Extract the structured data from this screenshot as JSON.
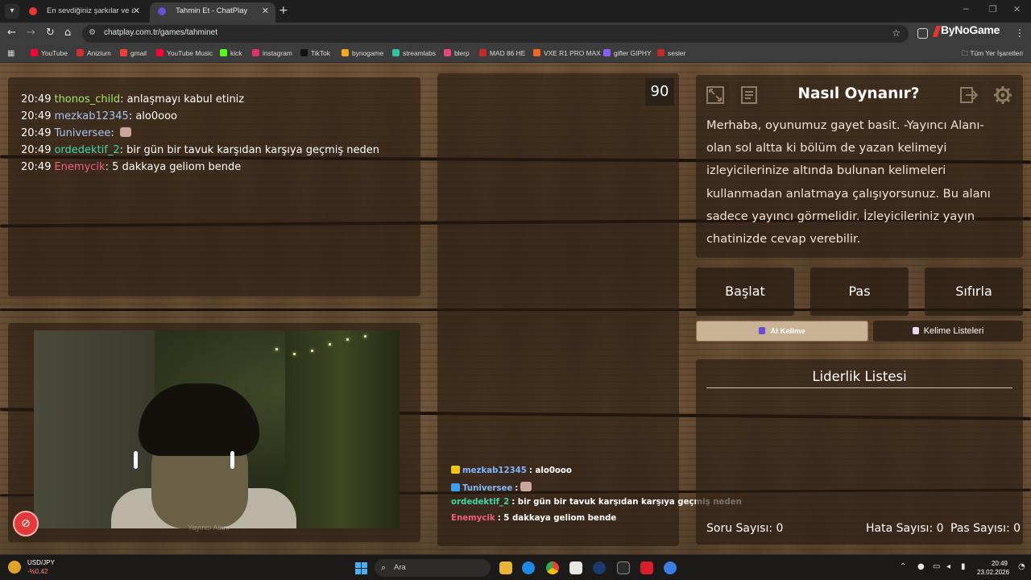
{
  "browser": {
    "tabs": [
      {
        "title": "En sevdiğiniz şarkılar ve albümle",
        "active": false,
        "favicon_color": "#e53935"
      },
      {
        "title": "Tahmin Et - ChatPlay",
        "active": true,
        "favicon_color": "#6a4fd8"
      }
    ],
    "new_tab": "+",
    "url": "chatplay.com.tr/games/tahminet",
    "brand": "ByNoGame",
    "bookmarks": [
      {
        "label": "YouTube",
        "color": "#ff0033"
      },
      {
        "label": "Anizium",
        "color": "#d32f2f"
      },
      {
        "label": "gmail",
        "color": "#ea4335"
      },
      {
        "label": "YouTube Music",
        "color": "#ff0033"
      },
      {
        "label": "kick",
        "color": "#53fc18"
      },
      {
        "label": "instagram",
        "color": "#e1306c"
      },
      {
        "label": "TikTok",
        "color": "#111111"
      },
      {
        "label": "bynogame",
        "color": "#f5a623"
      },
      {
        "label": "streamlabs",
        "color": "#31c3a2"
      },
      {
        "label": "blerp",
        "color": "#e8457a"
      },
      {
        "label": "MAD 86 HE",
        "color": "#c62828"
      },
      {
        "label": "VXE R1 PRO MAX",
        "color": "#f26522"
      },
      {
        "label": "gifler GIPHY",
        "color": "#8b5cf6"
      },
      {
        "label": "sesler",
        "color": "#c62828"
      }
    ],
    "all_bookmarks": "Tüm Yer İşaretleri"
  },
  "chat": {
    "messages": [
      {
        "time": "20:49",
        "user": "thonos_child",
        "user_color": "#a4e36b",
        "text": "anlaşmayı kabul etiniz",
        "emote": false
      },
      {
        "time": "20:49",
        "user": "mezkab12345",
        "user_color": "#a9c4f5",
        "text": "alo0ooo",
        "emote": false
      },
      {
        "time": "20:49",
        "user": "Tuniversee",
        "user_color": "#a9c4f5",
        "text": "",
        "emote": true
      },
      {
        "time": "20:49",
        "user": "ordedektif_2",
        "user_color": "#3fd6a6",
        "text": "bir gün bir tavuk karşıdan karşıya geçmiş neden",
        "emote": false
      },
      {
        "time": "20:49",
        "user": "Enemycik",
        "user_color": "#f0607a",
        "text": "5 dakkaya geliom bende",
        "emote": false
      }
    ]
  },
  "webcam": {
    "overlay_text": "Yayıncı Alanı"
  },
  "game": {
    "timer": "90",
    "feed": [
      {
        "user": "mezkab12345",
        "user_color": "#7eb6ff",
        "text": ": alo0ooo",
        "badge_color": "#f0c419",
        "emote": false
      },
      {
        "user": "Tuniversee",
        "user_color": "#7eb6ff",
        "text": ":",
        "badge_color": "#3aa0f0",
        "emote": true
      },
      {
        "user": "ordedektif_2",
        "user_color": "#3fd6a6",
        "text": ": bir gün bir tavuk karşıdan karşıya geçmiş neden",
        "badge_color": "",
        "emote": false
      },
      {
        "user": "Enemycik",
        "user_color": "#f0607a",
        "text": ": 5 dakkaya geliom bende",
        "badge_color": "",
        "emote": false
      }
    ]
  },
  "howto": {
    "title": "Nasıl Oynanır?",
    "text": "Merhaba, oyunumuz gayet basit. -Yayıncı Alanı- olan sol altta ki bölüm de yazan kelimeyi izleyicilerinize altında bulunan kelimeleri kullanmadan anlatmaya çalışıyorsunuz. Bu alanı sadece yayıncı görmelidir. İzleyicileriniz yayın chatinizde cevap verebilir."
  },
  "controls": {
    "start": "Başlat",
    "pass": "Pas",
    "reset": "Sıfırla",
    "ai_word": "AI Kelime",
    "word_lists": "Kelime Listeleri"
  },
  "leaderboard": {
    "title": "Liderlik Listesi"
  },
  "stats": {
    "question_label": "Soru Sayısı:",
    "question_count": "0",
    "error_label": "Hata Sayısı:",
    "error_count": "0",
    "pass_label": "Pas Sayısı:",
    "pass_count": "0"
  },
  "taskbar": {
    "ticker_symbol": "USD/JPY",
    "ticker_change": "-%0,42",
    "search_placeholder": "Ara",
    "time": "20:49",
    "date": "23.02.2026"
  }
}
